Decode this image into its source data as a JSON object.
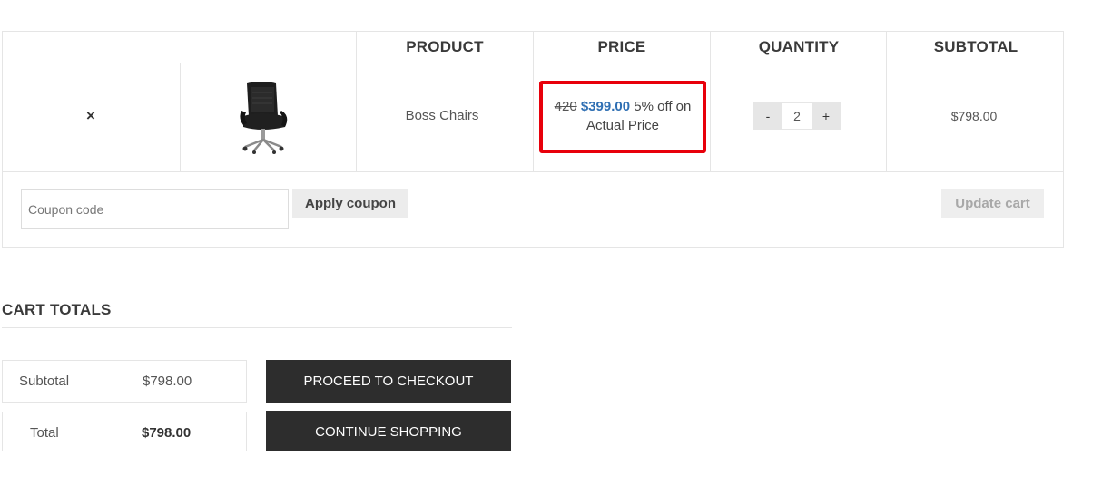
{
  "cart": {
    "headers": {
      "product": "PRODUCT",
      "price": "PRICE",
      "quantity": "QUANTITY",
      "subtotal": "SUBTOTAL"
    },
    "item": {
      "remove_icon": "×",
      "product_name": "Boss Chairs",
      "price_old": "420",
      "price_new": "$399.00",
      "price_note": "5% off on Actual Price",
      "qty_minus": "-",
      "qty_value": "2",
      "qty_plus": "+",
      "subtotal": "$798.00"
    },
    "coupon_placeholder": "Coupon code",
    "apply_coupon_label": "Apply coupon",
    "update_cart_label": "Update cart"
  },
  "totals": {
    "title": "CART TOTALS",
    "subtotal_label": "Subtotal",
    "subtotal_value": "$798.00",
    "total_label": "Total",
    "total_value": "$798.00",
    "checkout_label": "PROCEED TO CHECKOUT",
    "continue_label": "CONTINUE SHOPPING"
  },
  "colors": {
    "highlight_border": "#e8000b",
    "sale_price": "#2f6fb3",
    "dark_button": "#2d2d2d"
  }
}
